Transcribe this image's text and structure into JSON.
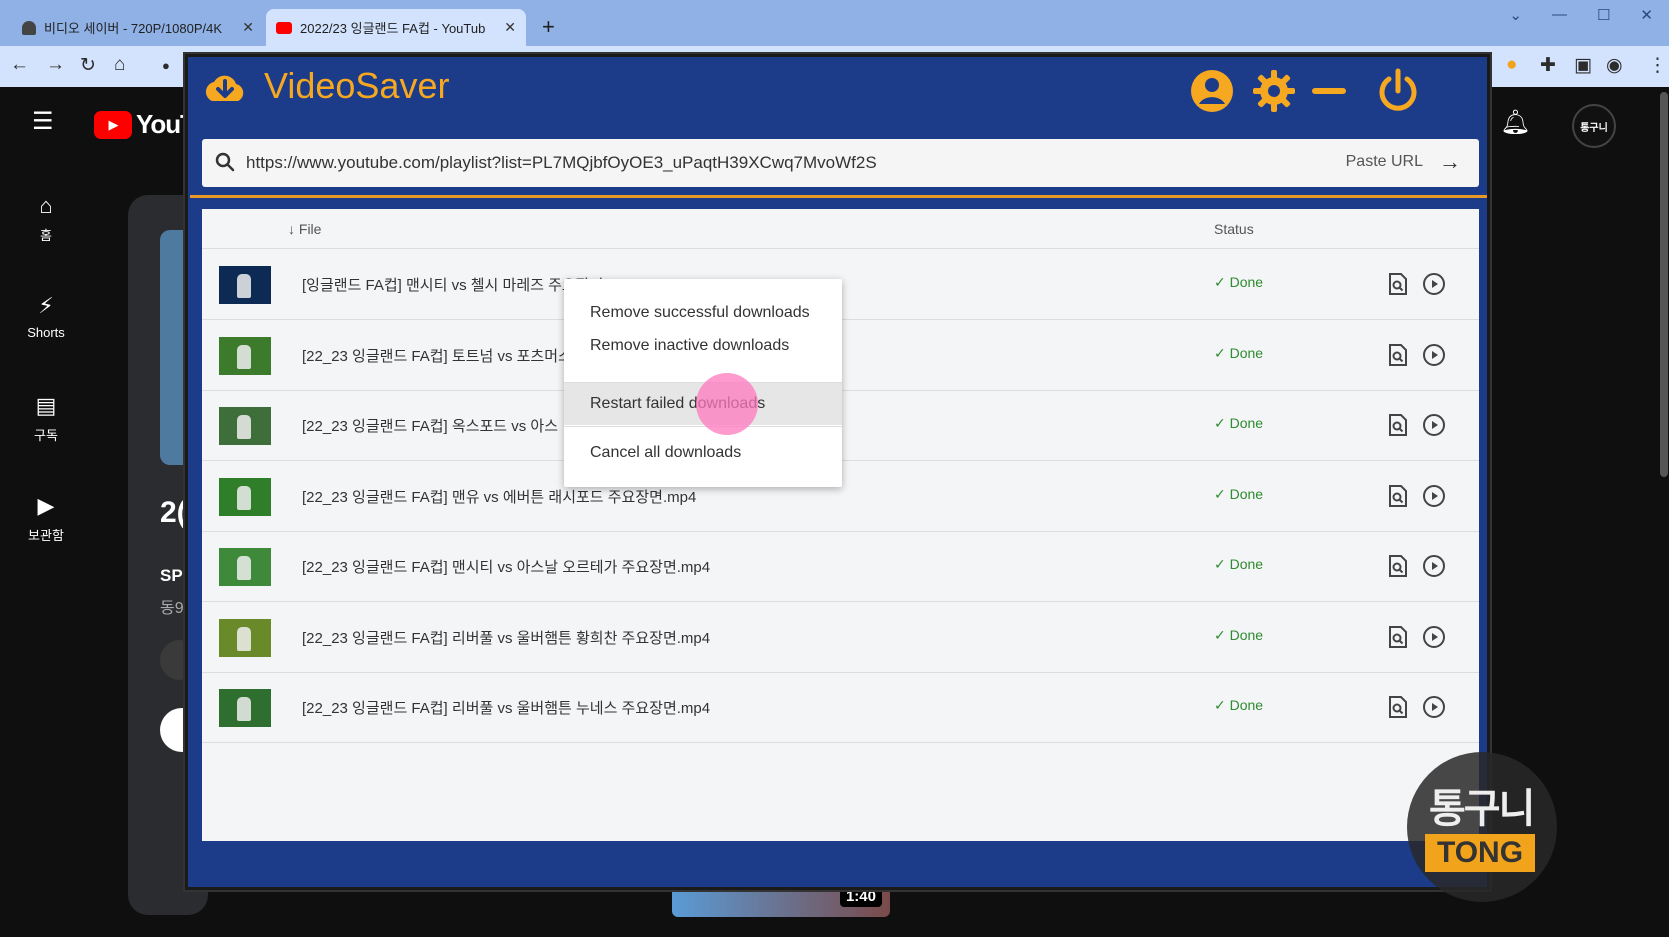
{
  "browser": {
    "tabs": [
      {
        "title": "비디오 세이버 - 720P/1080P/4K",
        "active": false
      },
      {
        "title": "2022/23 잉글랜드 FA컵 - YouTub",
        "active": true
      }
    ],
    "new_tab": "+",
    "win_controls": [
      "⌄",
      "—",
      "☐",
      "✕"
    ]
  },
  "youtube": {
    "logo_text": "YouTu",
    "nav": [
      {
        "label": "홈",
        "icon": "home-icon"
      },
      {
        "label": "Shorts",
        "icon": "shorts-icon"
      },
      {
        "label": "구독",
        "icon": "subscriptions-icon"
      },
      {
        "label": "보관함",
        "icon": "library-icon"
      }
    ],
    "card_year": "2(",
    "card_sp": "SP",
    "card_dong": "동9",
    "thumb_duration": "1:40"
  },
  "app": {
    "title": "VideoSaver",
    "url": "https://www.youtube.com/playlist?list=PL7MQjbfOyOE3_uPaqtH39XCwq7MvoWf2S",
    "paste_label": "Paste URL",
    "columns": {
      "file": "File",
      "status": "Status"
    },
    "rows": [
      {
        "name": "[잉글랜드 FA컵] 맨시티 vs 첼시 마레즈 주요장면.mp4",
        "status": "✓ Done"
      },
      {
        "name": "[22_23 잉글랜드 FA컵] 토트넘 vs 포츠머스",
        "status": "✓ Done"
      },
      {
        "name": "[22_23 잉글랜드 FA컵] 옥스포드 vs 아스",
        "status": "✓ Done"
      },
      {
        "name": "[22_23 잉글랜드 FA컵] 맨유 vs 에버튼 래시포드 주요장면.mp4",
        "status": "✓ Done"
      },
      {
        "name": "[22_23 잉글랜드 FA컵] 맨시티 vs 아스날 오르테가 주요장면.mp4",
        "status": "✓ Done"
      },
      {
        "name": "[22_23 잉글랜드 FA컵] 리버풀 vs 울버햄튼 황희찬 주요장면.mp4",
        "status": "✓ Done"
      },
      {
        "name": "[22_23 잉글랜드 FA컵] 리버풀 vs 울버햄튼 누네스 주요장면.mp4",
        "status": "✓ Done"
      }
    ],
    "context_menu": {
      "remove_successful": "Remove successful downloads",
      "remove_inactive": "Remove inactive downloads",
      "restart_failed": "Restart failed downloads",
      "cancel_all": "Cancel all downloads"
    }
  },
  "watermark": {
    "top": "통구니",
    "bottom": "TONG"
  },
  "avatar_text": "통구니",
  "colors": {
    "app_bg": "#1c3c8a",
    "accent": "#f6a821",
    "done": "#2e8b2e"
  }
}
